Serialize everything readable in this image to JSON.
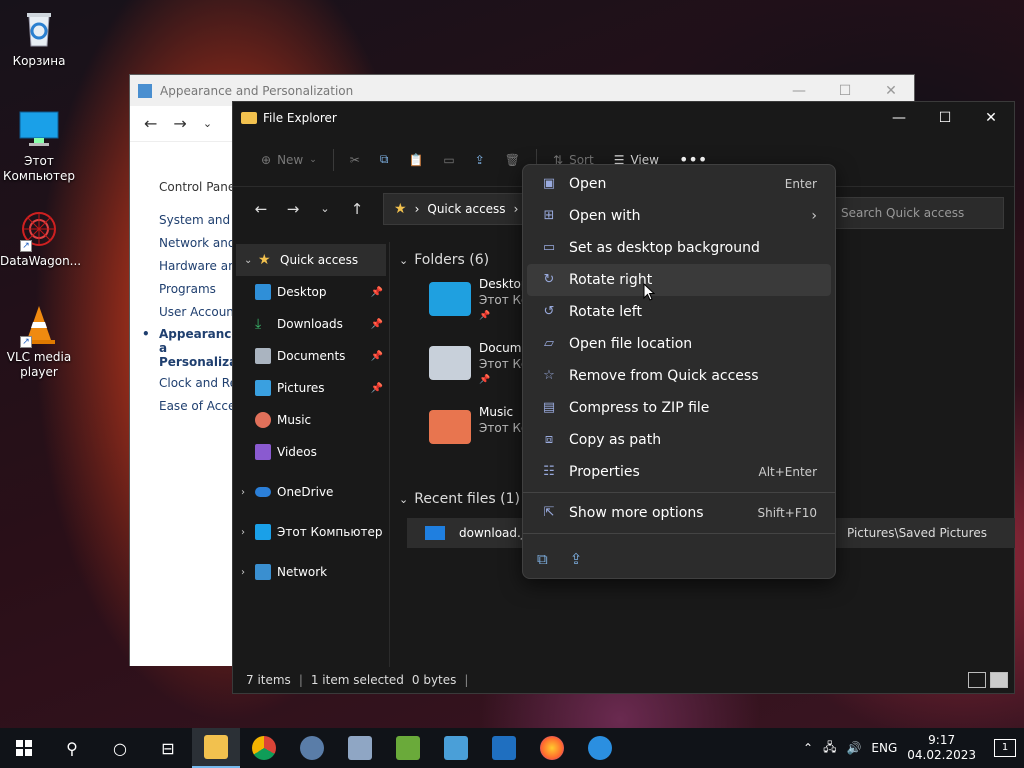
{
  "desktop": {
    "icons": [
      {
        "label": "Корзина",
        "icon": "recycle-bin-icon"
      },
      {
        "label": "Этот\nКомпьютер",
        "icon": "this-pc-icon"
      },
      {
        "label": "DataWagon...",
        "icon": "datawagon-icon"
      },
      {
        "label": "VLC media\nplayer",
        "icon": "vlc-icon"
      }
    ]
  },
  "appearance_window": {
    "title": "Appearance and Personalization",
    "sidebar": {
      "home": "Control Panel",
      "items": [
        "System and Se",
        "Network and",
        "Hardware and",
        "Programs",
        "User Accounts"
      ],
      "selected": "Appearance a\nPersonalizatio",
      "items_after": [
        "Clock and Reg",
        "Ease of Access"
      ]
    }
  },
  "explorer": {
    "title": "File Explorer",
    "toolbar": {
      "new_label": "New",
      "sort_label": "Sort",
      "view_label": "View"
    },
    "address": {
      "location": "Quick access",
      "search_placeholder": "Search Quick access"
    },
    "sidebar": {
      "quick_access": "Quick access",
      "pinned": [
        {
          "label": "Desktop",
          "color": "#2f8fd8"
        },
        {
          "label": "Downloads",
          "color": "#3ab86b"
        },
        {
          "label": "Documents",
          "color": "#aab4c0"
        },
        {
          "label": "Pictures",
          "color": "#3aa0e0"
        },
        {
          "label": "Music",
          "color": "#e0705a"
        },
        {
          "label": "Videos",
          "color": "#8a5ad0"
        }
      ],
      "onedrive": "OneDrive",
      "this_pc": "Этот Компьютер",
      "network": "Network"
    },
    "folders_heading": "Folders (6)",
    "folders": [
      {
        "name": "Desktop",
        "sub": "Этот Ко",
        "color": "#1fa0e0"
      },
      {
        "name": "Docume",
        "sub": "Этот Ко",
        "color": "#c8d0da"
      },
      {
        "name": "Music",
        "sub": "Этот Ко",
        "color": "#e8754f"
      }
    ],
    "recent_heading": "Recent files (1)",
    "recent": {
      "name": "download.jp",
      "path": "Pictures\\Saved Pictures"
    },
    "status": {
      "items": "7 items",
      "selected": "1 item selected",
      "size": "0 bytes"
    }
  },
  "context_menu": {
    "items": [
      {
        "label": "Open",
        "shortcut": "Enter",
        "icon": "image-icon"
      },
      {
        "label": "Open with",
        "shortcut": "›",
        "icon": "open-with-icon"
      },
      {
        "label": "Set as desktop background",
        "shortcut": "",
        "icon": "desktop-background-icon"
      },
      {
        "label": "Rotate right",
        "shortcut": "",
        "icon": "rotate-right-icon"
      },
      {
        "label": "Rotate left",
        "shortcut": "",
        "icon": "rotate-left-icon"
      },
      {
        "label": "Open file location",
        "shortcut": "",
        "icon": "folder-icon"
      },
      {
        "label": "Remove from Quick access",
        "shortcut": "",
        "icon": "star-icon"
      },
      {
        "label": "Compress to ZIP file",
        "shortcut": "",
        "icon": "zip-icon"
      },
      {
        "label": "Copy as path",
        "shortcut": "",
        "icon": "copy-path-icon"
      },
      {
        "label": "Properties",
        "shortcut": "Alt+Enter",
        "icon": "properties-icon"
      }
    ],
    "more": {
      "label": "Show more options",
      "shortcut": "Shift+F10"
    }
  },
  "taskbar": {
    "language": "ENG",
    "time": "9:17",
    "date": "04.02.2023",
    "notification_count": "1"
  }
}
